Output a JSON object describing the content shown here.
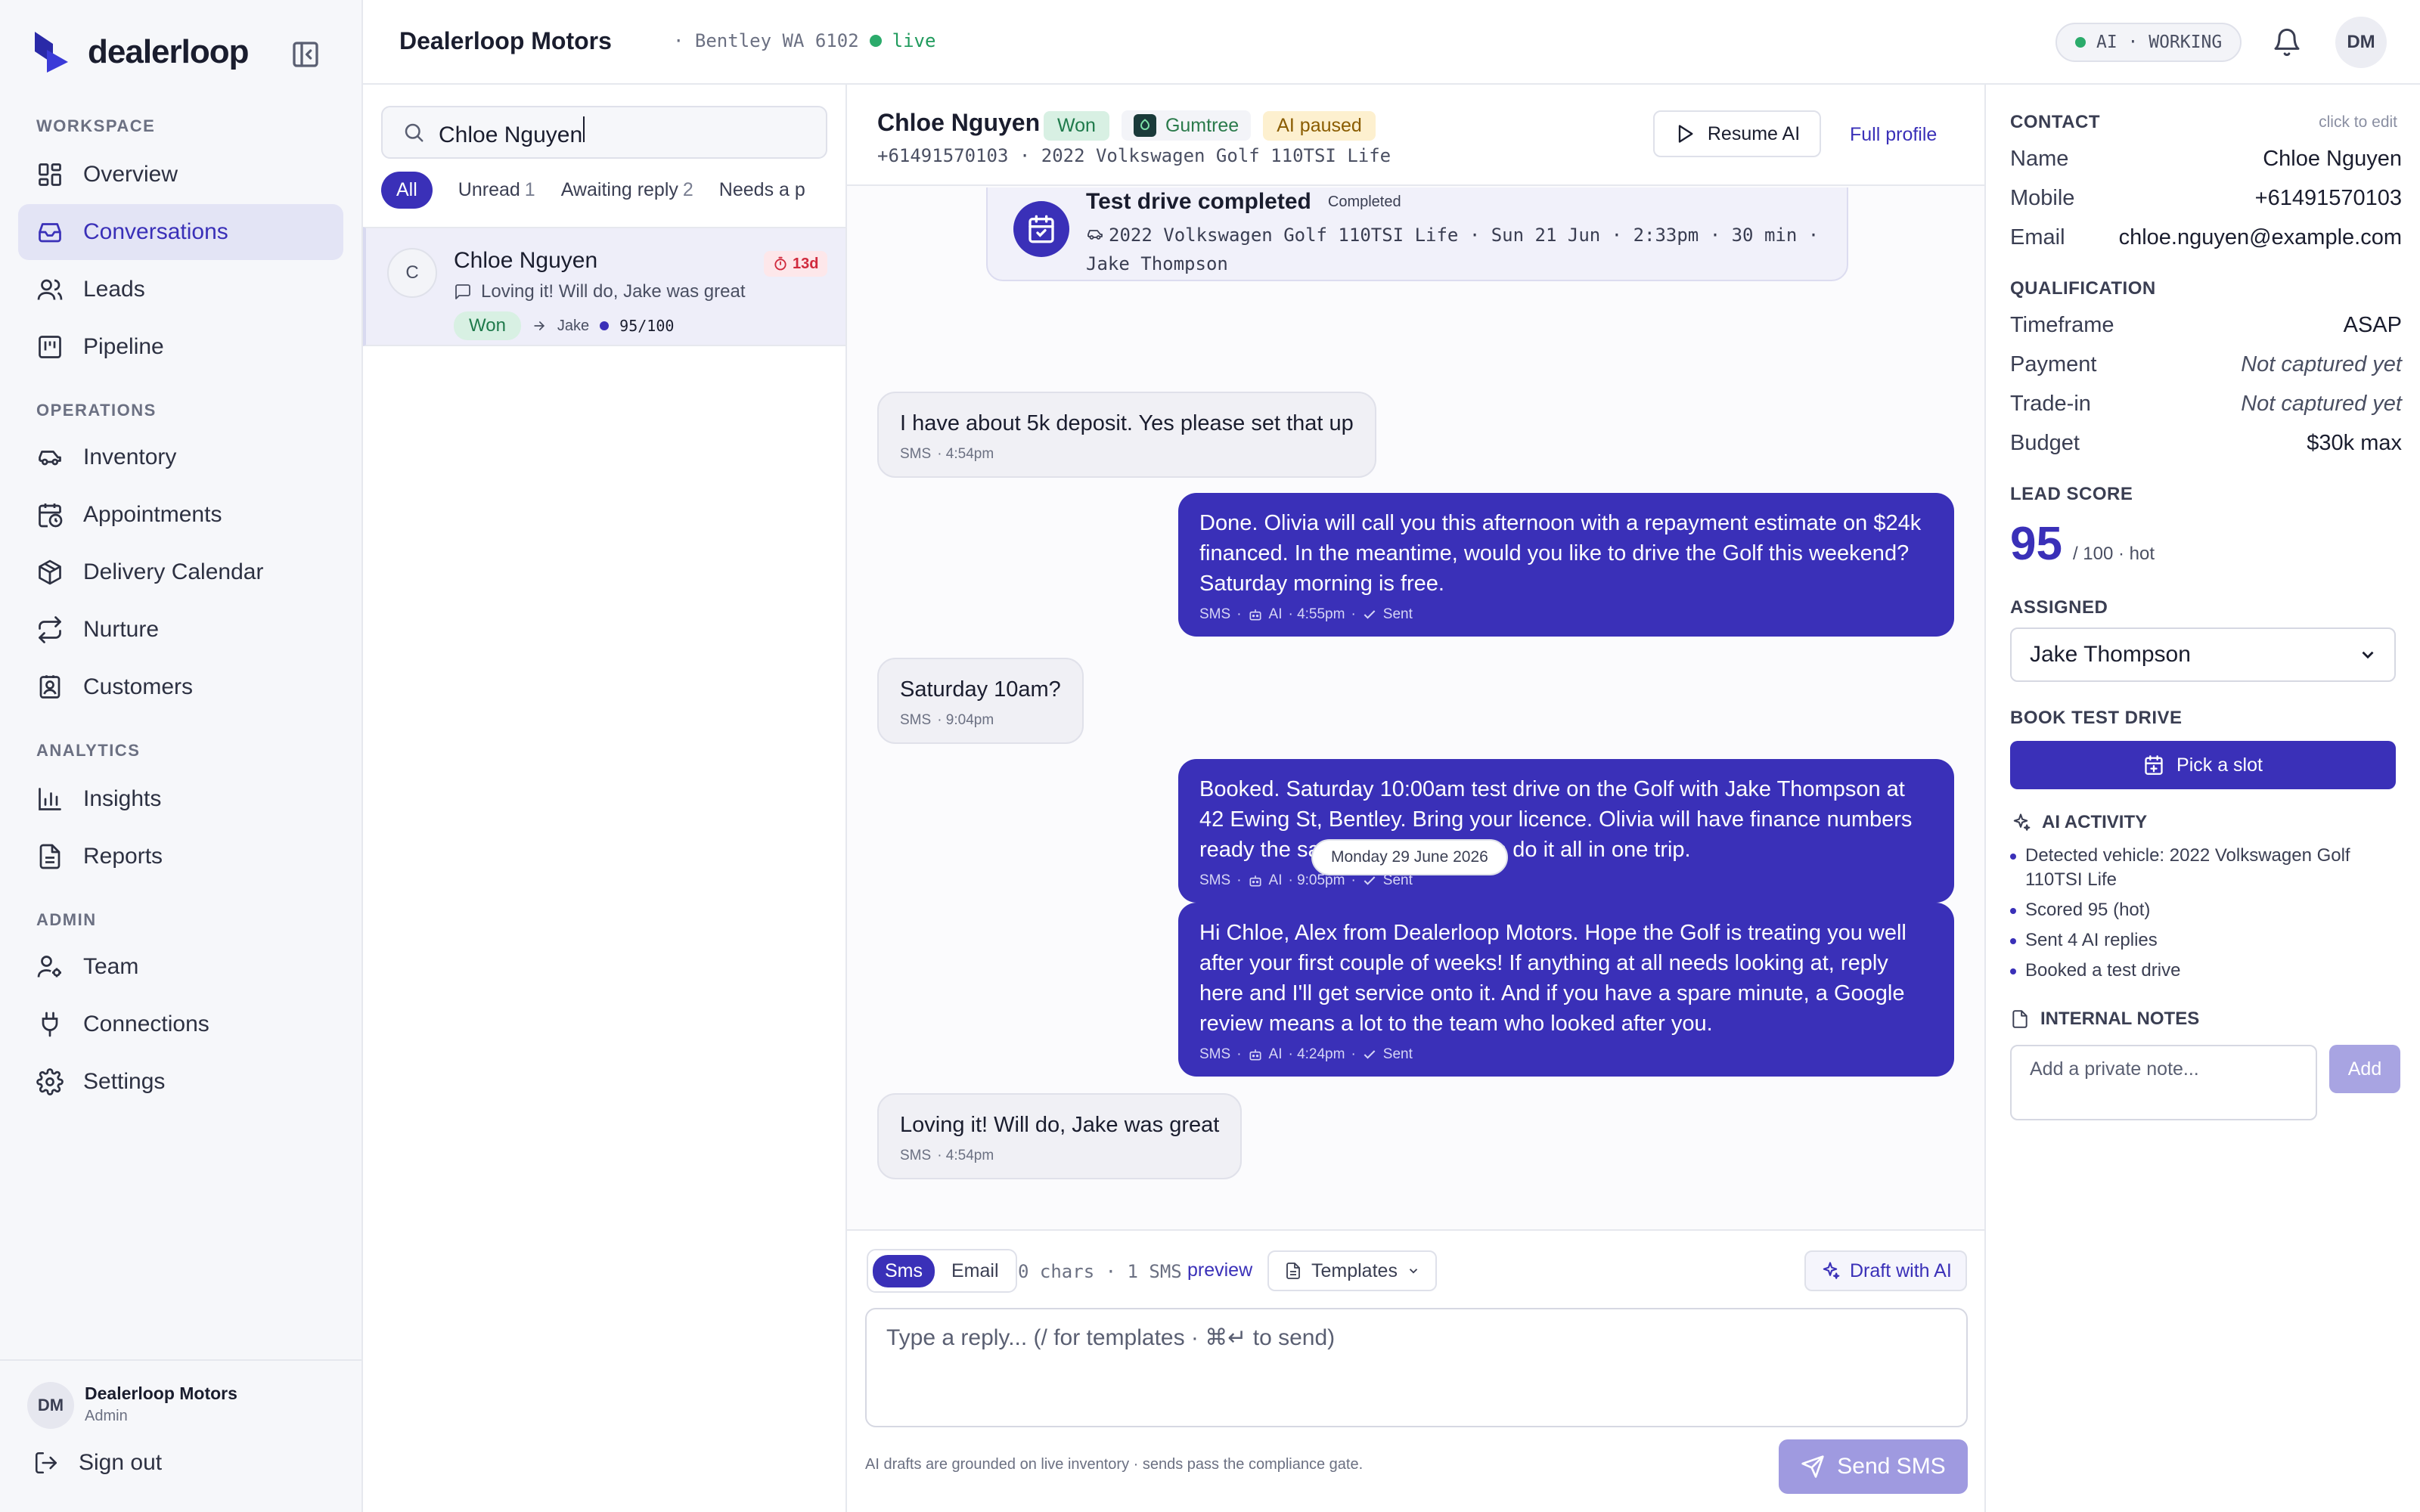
{
  "brand": {
    "name": "dealerloop"
  },
  "sidebar": {
    "sections": {
      "workspace": "WORKSPACE",
      "operations": "OPERATIONS",
      "analytics": "ANALYTICS",
      "admin": "ADMIN"
    },
    "items": [
      {
        "label": "Overview",
        "icon": "grid-icon"
      },
      {
        "label": "Conversations",
        "icon": "inbox-icon",
        "active": true
      },
      {
        "label": "Leads",
        "icon": "users-icon"
      },
      {
        "label": "Pipeline",
        "icon": "kanban-icon"
      },
      {
        "label": "Inventory",
        "icon": "car-icon"
      },
      {
        "label": "Appointments",
        "icon": "calendar-clock-icon"
      },
      {
        "label": "Delivery Calendar",
        "icon": "package-icon"
      },
      {
        "label": "Nurture",
        "icon": "repeat-icon"
      },
      {
        "label": "Customers",
        "icon": "contact-icon"
      },
      {
        "label": "Insights",
        "icon": "bar-chart-icon"
      },
      {
        "label": "Reports",
        "icon": "file-text-icon"
      },
      {
        "label": "Team",
        "icon": "user-cog-icon"
      },
      {
        "label": "Connections",
        "icon": "plug-icon"
      },
      {
        "label": "Settings",
        "icon": "gear-icon"
      }
    ],
    "footer": {
      "avatar": "DM",
      "name": "Dealerloop Motors",
      "role": "Admin",
      "sign_out": "Sign out"
    }
  },
  "topbar": {
    "dealer": "Dealerloop Motors",
    "location": "· Bentley WA 6102",
    "status": "live",
    "ai_status": "AI · WORKING",
    "avatar": "DM"
  },
  "conversation_list": {
    "search_value": "Chloe Nguyen",
    "filters": [
      {
        "label": "All",
        "active": true
      },
      {
        "label": "Unread",
        "count": "1"
      },
      {
        "label": "Awaiting reply",
        "count": "2"
      },
      {
        "label": "Needs a p"
      }
    ],
    "items": [
      {
        "initial": "C",
        "name": "Chloe Nguyen",
        "age": "13d",
        "preview": "Loving it! Will do, Jake was great",
        "status": "Won",
        "assignee": "Jake",
        "score": "95/100"
      }
    ]
  },
  "thread": {
    "name": "Chloe Nguyen",
    "badges": {
      "status": "Won",
      "source": "Gumtree",
      "ai": "AI paused"
    },
    "subline": "+61491570103 · 2022 Volkswagen Golf 110TSI Life",
    "resume_label": "Resume AI",
    "full_profile_label": "Full profile",
    "event": {
      "title": "Test drive completed",
      "status": "Completed",
      "detail": "2022 Volkswagen Golf 110TSI Life · Sun 21 Jun · 2:33pm · 30 min · Jake Thompson"
    },
    "messages": [
      {
        "dir": "in",
        "text": "I have about 5k deposit. Yes please set that up",
        "channel": "SMS",
        "time": "· 4:54pm"
      },
      {
        "dir": "out",
        "text": "Done. Olivia will call you this afternoon with a repayment estimate on $24k financed. In the meantime, would you like to drive the Golf this weekend? Saturday morning is free.",
        "channel": "SMS",
        "ai": "AI",
        "time": "· 4:55pm",
        "status": "Sent"
      },
      {
        "dir": "in",
        "text": "Saturday 10am?",
        "channel": "SMS",
        "time": "· 9:04pm"
      },
      {
        "dir": "out",
        "text": "Booked. Saturday 10:00am test drive on the Golf with Jake Thompson at 42 Ewing St, Bentley. Bring your licence. Olivia will have finance numbers ready the same visit so you can do it all in one trip.",
        "channel": "SMS",
        "ai": "AI",
        "time": "· 9:05pm",
        "status": "Sent"
      },
      {
        "dir": "out",
        "text": "Hi Chloe, Alex from Dealerloop Motors. Hope the Golf is treating you well after your first couple of weeks! If anything at all needs looking at, reply here and I'll get service onto it. And if you have a spare minute, a Google review means a lot to the team who looked after you.",
        "channel": "SMS",
        "ai": "AI",
        "time": "· 4:24pm",
        "status": "Sent"
      },
      {
        "dir": "in",
        "text": "Loving it! Will do, Jake was great",
        "channel": "SMS",
        "time": "· 4:54pm"
      }
    ],
    "date_divider": "Monday 29 June 2026",
    "composer": {
      "tabs": [
        "Sms",
        "Email"
      ],
      "chars": "0 chars · 1 SMS",
      "preview": "preview",
      "templates": "Templates",
      "draft": "Draft with AI",
      "placeholder": "Type a reply... (/ for templates · ⌘↵ to send)",
      "disclaimer": "AI drafts are grounded on live inventory · sends pass the compliance gate.",
      "send": "Send SMS"
    }
  },
  "panel": {
    "contact": {
      "heading": "CONTACT",
      "edit_hint": "click to edit",
      "name_label": "Name",
      "name": "Chloe Nguyen",
      "mobile_label": "Mobile",
      "mobile": "+61491570103",
      "email_label": "Email",
      "email": "chloe.nguyen@example.com"
    },
    "qualification": {
      "heading": "QUALIFICATION",
      "timeframe_label": "Timeframe",
      "timeframe": "ASAP",
      "payment_label": "Payment",
      "payment": "Not captured yet",
      "tradein_label": "Trade-in",
      "tradein": "Not captured yet",
      "budget_label": "Budget",
      "budget": "$30k max"
    },
    "lead_score": {
      "heading": "LEAD SCORE",
      "value": "95",
      "suffix": "/ 100 · hot"
    },
    "assigned": {
      "heading": "ASSIGNED",
      "value": "Jake Thompson"
    },
    "book": {
      "heading": "BOOK TEST DRIVE",
      "button": "Pick a slot"
    },
    "ai_activity": {
      "heading": "AI ACTIVITY",
      "items": [
        "Detected vehicle: 2022 Volkswagen Golf 110TSI Life",
        "Scored 95 (hot)",
        "Sent 4 AI replies",
        "Booked a test drive"
      ]
    },
    "notes": {
      "heading": "INTERNAL NOTES",
      "placeholder": "Add a private note...",
      "add": "Add"
    }
  },
  "colors": {
    "accent": "#3a30b8",
    "won": "#1f7a4b",
    "live": "#2bab6b",
    "alert": "#d02a3d"
  }
}
